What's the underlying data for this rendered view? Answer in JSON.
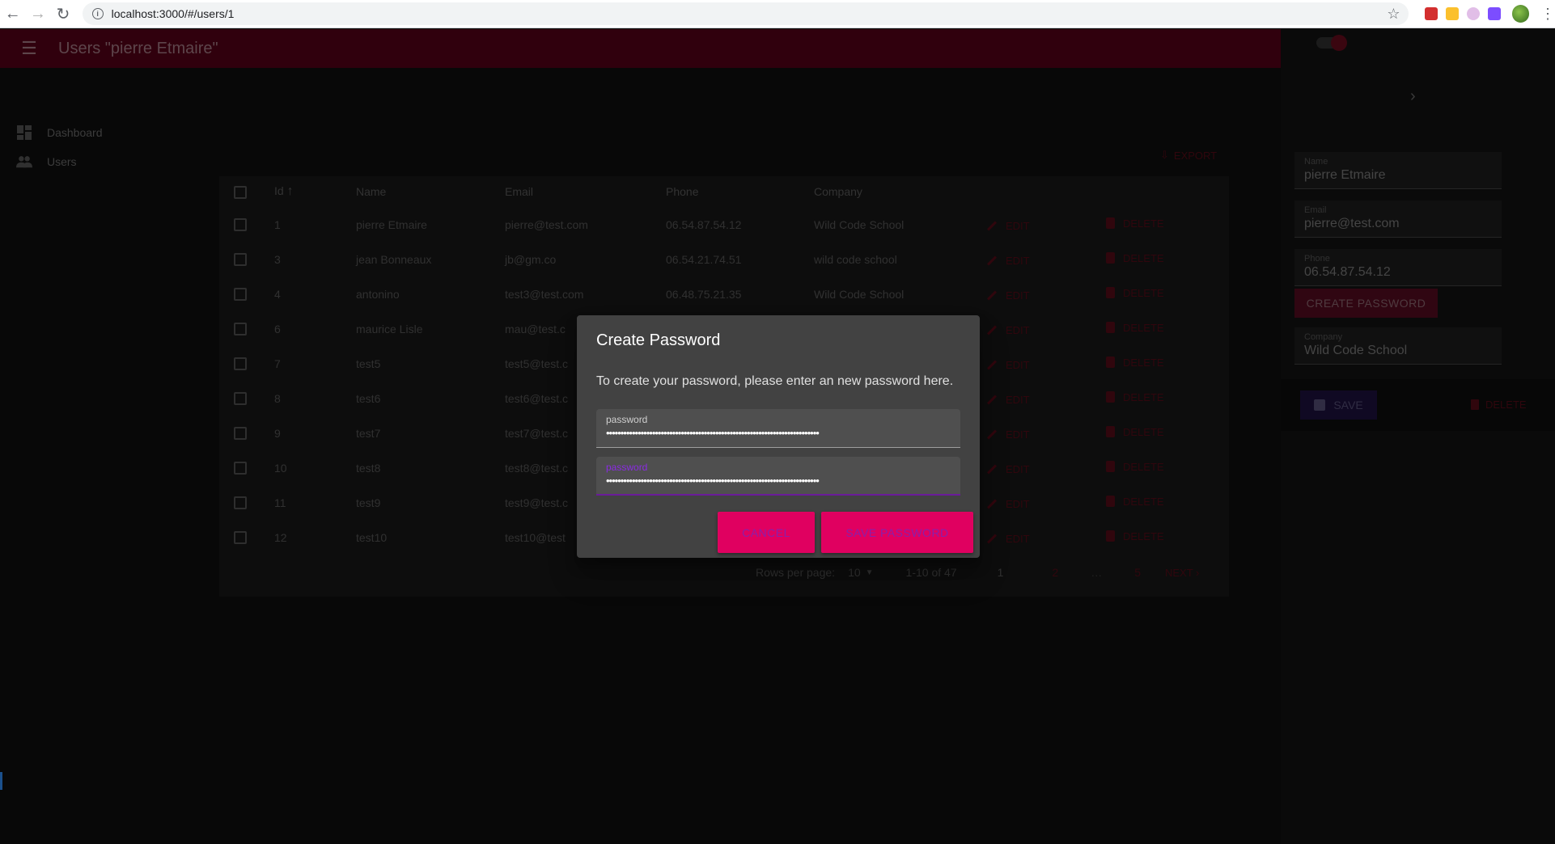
{
  "browser": {
    "url": "localhost:3000/#/users/1"
  },
  "appbar": {
    "title": "Users \"pierre Etmaire\""
  },
  "sidebar": {
    "items": [
      {
        "label": "Dashboard",
        "icon": "dashboard-icon"
      },
      {
        "label": "Users",
        "icon": "people-icon"
      }
    ]
  },
  "toolbar": {
    "export_label": "EXPORT"
  },
  "table": {
    "columns": [
      "Id",
      "Name",
      "Email",
      "Phone",
      "Company"
    ],
    "sort_column": "Id",
    "edit_label": "EDIT",
    "delete_label": "DELETE",
    "rows": [
      {
        "id": "1",
        "name": "pierre Etmaire",
        "email": "pierre@test.com",
        "phone": "06.54.87.54.12",
        "company": "Wild Code School"
      },
      {
        "id": "3",
        "name": "jean Bonneaux",
        "email": "jb@gm.co",
        "phone": "06.54.21.74.51",
        "company": "wild code school"
      },
      {
        "id": "4",
        "name": "antonino",
        "email": "test3@test.com",
        "phone": "06.48.75.21.35",
        "company": "Wild Code School"
      },
      {
        "id": "6",
        "name": "maurice Lisle",
        "email": "mau@test.c",
        "phone": "",
        "company": ""
      },
      {
        "id": "7",
        "name": "test5",
        "email": "test5@test.c",
        "phone": "",
        "company": ""
      },
      {
        "id": "8",
        "name": "test6",
        "email": "test6@test.c",
        "phone": "",
        "company": ""
      },
      {
        "id": "9",
        "name": "test7",
        "email": "test7@test.c",
        "phone": "",
        "company": ""
      },
      {
        "id": "10",
        "name": "test8",
        "email": "test8@test.c",
        "phone": "",
        "company": ""
      },
      {
        "id": "11",
        "name": "test9",
        "email": "test9@test.c",
        "phone": "",
        "company": ""
      },
      {
        "id": "12",
        "name": "test10",
        "email": "test10@test",
        "phone": "",
        "company": ""
      }
    ]
  },
  "pagination": {
    "rows_per_page_label": "Rows per page:",
    "rows_per_page_value": "10",
    "range": "1-10 of 47",
    "current_page": "1",
    "page_2": "2",
    "ellipsis": "…",
    "last_page": "5",
    "next_label": "NEXT"
  },
  "drawer": {
    "fields": [
      {
        "label": "Name",
        "value": "pierre Etmaire"
      },
      {
        "label": "Email",
        "value": "pierre@test.com"
      },
      {
        "label": "Phone",
        "value": "06.54.87.54.12"
      },
      {
        "label": "Company",
        "value": "Wild Code School"
      }
    ],
    "create_password_label": "CREATE PASSWORD",
    "save_label": "SAVE",
    "delete_label": "DELETE"
  },
  "modal": {
    "title": "Create Password",
    "text": "To create your password, please enter an new password here.",
    "field1": {
      "label": "password",
      "value": "••••••••••••••••••••••••••••••••••••••••••••••••••••••••••••••••••••••••••"
    },
    "field2": {
      "label": "password",
      "value": "••••••••••••••••••••••••••••••••••••••••••••••••••••••••••••••••••••••••••"
    },
    "cancel_label": "CANCEL",
    "save_label": "SAVE PASSWORD"
  },
  "colors": {
    "appbar": "#4a0014",
    "accent": "#e00060",
    "focus": "#6a1b9a"
  }
}
